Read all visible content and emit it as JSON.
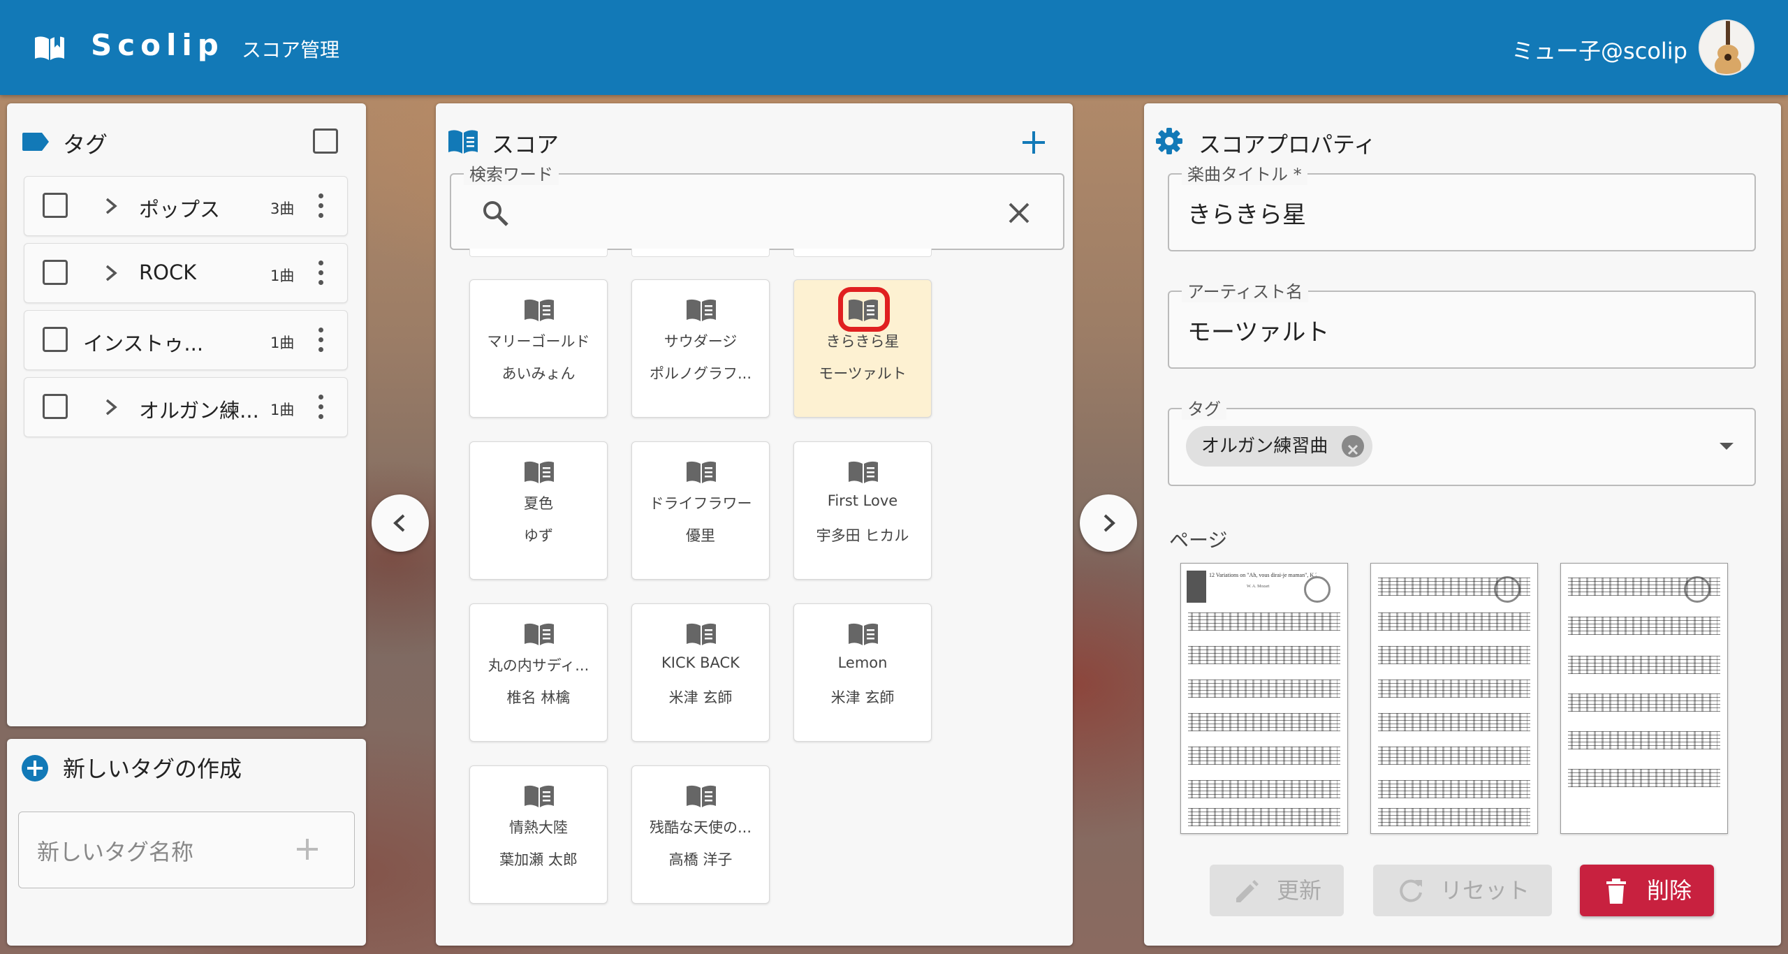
{
  "header": {
    "app_name": "Scolip",
    "nav_link": "スコア管理",
    "user_name": "ミュー子@scolip",
    "accent_color": "#1279b7"
  },
  "tags_panel": {
    "title": "タグ",
    "items": [
      {
        "name": "ポップス",
        "count": "3曲",
        "expandable": true
      },
      {
        "name": "ROCK",
        "count": "1曲",
        "expandable": true
      },
      {
        "name": "インストゥ...",
        "count": "1曲",
        "expandable": false
      },
      {
        "name": "オルガン練...",
        "count": "1曲",
        "expandable": true
      }
    ]
  },
  "new_tag_panel": {
    "title": "新しいタグの作成",
    "placeholder": "新しいタグ名称"
  },
  "score_panel": {
    "title": "スコア",
    "search_label": "検索ワード",
    "search_value": "",
    "cards": [
      {
        "title": "マリーゴールド",
        "artist": "あいみょん",
        "selected": false
      },
      {
        "title": "サウダージ",
        "artist": "ポルノグラフ...",
        "selected": false
      },
      {
        "title": "きらきら星",
        "artist": "モーツァルト",
        "selected": true
      },
      {
        "title": "夏色",
        "artist": "ゆず",
        "selected": false
      },
      {
        "title": "ドライフラワー",
        "artist": "優里",
        "selected": false
      },
      {
        "title": "First Love",
        "artist": "宇多田 ヒカル",
        "selected": false
      },
      {
        "title": "丸の内サディ...",
        "artist": "椎名 林檎",
        "selected": false
      },
      {
        "title": "KICK BACK",
        "artist": "米津 玄師",
        "selected": false
      },
      {
        "title": "Lemon",
        "artist": "米津 玄師",
        "selected": false
      },
      {
        "title": "情熱大陸",
        "artist": "葉加瀬 太郎",
        "selected": false
      },
      {
        "title": "残酷な天使の...",
        "artist": "高橋 洋子",
        "selected": false
      }
    ]
  },
  "properties_panel": {
    "title": "スコアプロパティ",
    "song_title_label": "楽曲タイトル *",
    "song_title_value": "きらきら星",
    "artist_label": "アーティスト名",
    "artist_value": "モーツァルト",
    "tag_label": "タグ",
    "tag_chip": "オルガン練習曲",
    "pages_label": "ページ",
    "page_header": "12 Variations on \"Ah, vous dirai-je maman\", K.265",
    "page_composer": "W. A. Mozart",
    "update_label": "更新",
    "reset_label": "リセット",
    "delete_label": "削除",
    "delete_color": "#c8213f"
  }
}
